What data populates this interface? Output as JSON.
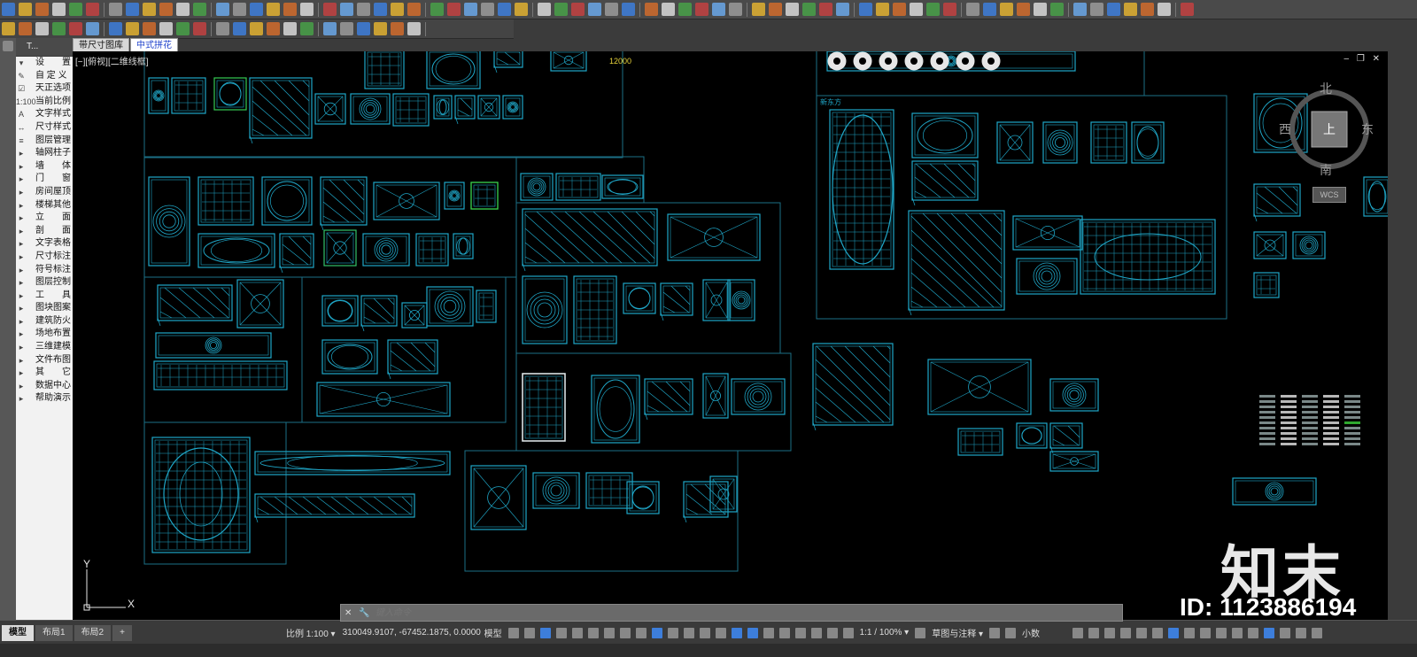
{
  "drawing_tabs": [
    "带尺寸图库",
    "中式拼花"
  ],
  "active_drawing_tab": "中式拼花",
  "sidebar": {
    "header": "T...",
    "items": [
      {
        "label": "设　　置",
        "icon": "▾"
      },
      {
        "label": "自 定 义",
        "icon": "✎"
      },
      {
        "label": "天正选项",
        "icon": "☑"
      },
      {
        "label": "当前比例",
        "icon": "1:100"
      },
      {
        "label": "文字样式",
        "icon": "A"
      },
      {
        "label": "尺寸样式",
        "icon": "↔"
      },
      {
        "label": "图层管理",
        "icon": "≡"
      },
      {
        "label": "轴网柱子",
        "icon": "▸"
      },
      {
        "label": "墙　　体",
        "icon": "▸"
      },
      {
        "label": "门　　窗",
        "icon": "▸"
      },
      {
        "label": "房间屋顶",
        "icon": "▸"
      },
      {
        "label": "楼梯其他",
        "icon": "▸"
      },
      {
        "label": "立　　面",
        "icon": "▸"
      },
      {
        "label": "剖　　面",
        "icon": "▸"
      },
      {
        "label": "文字表格",
        "icon": "▸"
      },
      {
        "label": "尺寸标注",
        "icon": "▸"
      },
      {
        "label": "符号标注",
        "icon": "▸"
      },
      {
        "label": "图层控制",
        "icon": "▸"
      },
      {
        "label": "工　　具",
        "icon": "▸"
      },
      {
        "label": "图块图案",
        "icon": "▸"
      },
      {
        "label": "建筑防火",
        "icon": "▸"
      },
      {
        "label": "场地布置",
        "icon": "▸"
      },
      {
        "label": "三维建模",
        "icon": "▸"
      },
      {
        "label": "文件布图",
        "icon": "▸"
      },
      {
        "label": "其　　它",
        "icon": "▸"
      },
      {
        "label": "数据中心",
        "icon": "▸"
      },
      {
        "label": "帮助演示",
        "icon": "▸"
      }
    ]
  },
  "viewport": {
    "label": "[−][俯视][二维线框]",
    "controls": "‒ ❐ ✕",
    "viewcube": {
      "north": "北",
      "south": "南",
      "east": "东",
      "west": "西",
      "top": "上"
    },
    "wcs": "WCS",
    "ucs_x": "X",
    "ucs_y": "Y",
    "drawing_note_1": "12000",
    "drawing_note_2": "新东方"
  },
  "command": {
    "placeholder": "键入命令",
    "close": "✕",
    "settings": "🔧"
  },
  "status": {
    "layout_tabs": [
      "模型",
      "布局1",
      "布局2"
    ],
    "add_tab": "+",
    "scale": "比例 1:100 ▾",
    "coords": "310049.9107, -67452.1875, 0.0000",
    "model": "模型",
    "annotation_scale": "1:1 / 100% ▾",
    "workspace": "草图与注释 ▾",
    "units": "小数"
  },
  "watermark": {
    "brand": "知末",
    "id": "ID: 1123886194"
  },
  "colors": {
    "line": "#1fa6c7",
    "frame": "#1b6f86",
    "white": "#e6e6e6",
    "yellow": "#e6d23a",
    "green": "#3bd23b"
  }
}
